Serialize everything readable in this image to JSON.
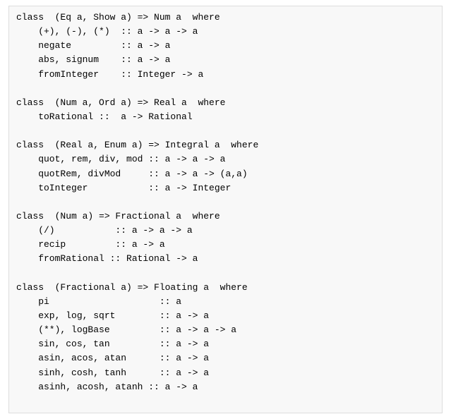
{
  "code": {
    "sections": [
      {
        "id": "num-class",
        "lines": [
          "class  (Eq a, Show a) => Num a  where",
          "    (+), (-), (*)  :: a -> a -> a",
          "    negate         :: a -> a",
          "    abs, signum    :: a -> a",
          "    fromInteger    :: Integer -> a"
        ]
      },
      {
        "id": "real-class",
        "lines": [
          "class  (Num a, Ord a) => Real a  where",
          "    toRational ::  a -> Rational"
        ]
      },
      {
        "id": "integral-class",
        "lines": [
          "class  (Real a, Enum a) => Integral a  where",
          "    quot, rem, div, mod :: a -> a -> a",
          "    quotRem, divMod     :: a -> a -> (a,a)",
          "    toInteger           :: a -> Integer"
        ]
      },
      {
        "id": "fractional-class",
        "lines": [
          "class  (Num a) => Fractional a  where",
          "    (/)           :: a -> a -> a",
          "    recip         :: a -> a",
          "    fromRational :: Rational -> a"
        ]
      },
      {
        "id": "floating-class",
        "lines": [
          "class  (Fractional a) => Floating a  where",
          "    pi                    :: a",
          "    exp, log, sqrt        :: a -> a",
          "    (**), logBase         :: a -> a -> a",
          "    sin, cos, tan         :: a -> a",
          "    asin, acos, atan      :: a -> a",
          "    sinh, cosh, tanh      :: a -> a",
          "    asinh, acosh, atanh :: a -> a"
        ]
      }
    ]
  }
}
